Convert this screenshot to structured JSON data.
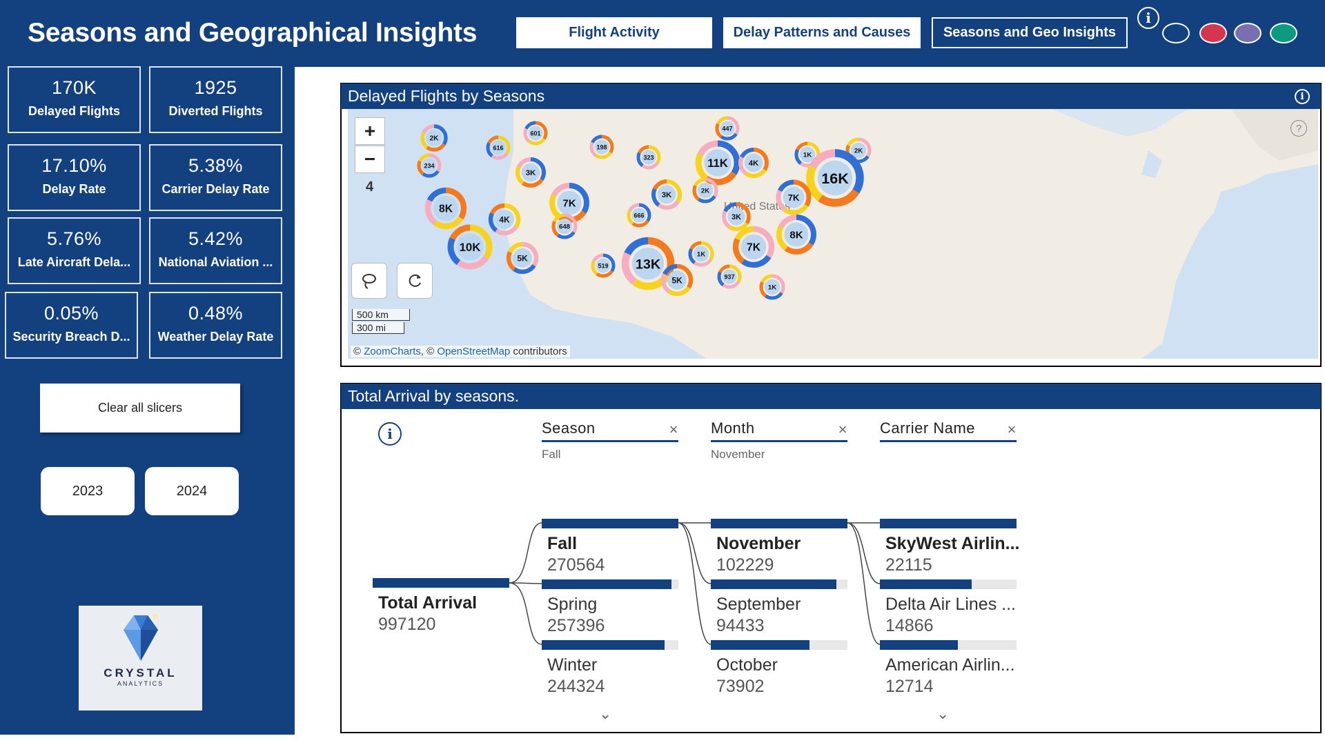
{
  "header": {
    "title": "Seasons and Geographical Insights",
    "nav": [
      "Flight Activity",
      "Delay Patterns and Causes",
      "Seasons and Geo Insights"
    ],
    "info_icon": "info-icon",
    "theme_colors": [
      "#13407f",
      "#d6354f",
      "#7a6fae",
      "#0d9b7f"
    ]
  },
  "kpis": [
    {
      "value": "170K",
      "label": "Delayed Flights"
    },
    {
      "value": "1925",
      "label": "Diverted Flights"
    },
    {
      "value": "17.10%",
      "label": "Delay Rate"
    },
    {
      "value": "5.38%",
      "label": "Carrier Delay Rate"
    },
    {
      "value": "5.76%",
      "label": "Late Aircraft Dela..."
    },
    {
      "value": "5.42%",
      "label": "National Aviation ..."
    },
    {
      "value": "0.05%",
      "label": "Security Breach D..."
    },
    {
      "value": "0.48%",
      "label": "Weather Delay Rate"
    }
  ],
  "sidebar": {
    "clear_label": "Clear all slicers",
    "years": [
      "2023",
      "2024"
    ],
    "logo_text": "CRYSTAL",
    "logo_sub": "ANALYTICS"
  },
  "map_panel": {
    "title": "Delayed Flights by Seasons",
    "zoom_in": "+",
    "zoom_out": "−",
    "zoom_level": "4",
    "country_label": "United States",
    "scale_km": "500 km",
    "scale_mi": "300 mi",
    "attribution_prefix": "© ",
    "attribution_zc": "ZoomCharts",
    "attribution_mid": ", © ",
    "attribution_osm": "OpenStreetMap",
    "attribution_suffix": " contributors",
    "help_icon": "?",
    "cluster_colors": [
      "#2f6fd6",
      "#f47a1f",
      "#f7d21e",
      "#f6adc0"
    ],
    "clusters": [
      "2K",
      "601",
      "616",
      "234",
      "3K",
      "198",
      "323",
      "447",
      "11K",
      "4K",
      "1K",
      "2K",
      "16K",
      "7K",
      "3K",
      "2K",
      "7K",
      "8K",
      "4K",
      "648",
      "666",
      "3K",
      "10K",
      "5K",
      "519",
      "13K",
      "1K",
      "7K",
      "8K",
      "5K",
      "937",
      "1K"
    ]
  },
  "tree_panel": {
    "title": "Total Arrival by seasons.",
    "slicers": [
      {
        "name": "Season",
        "selected": "Fall"
      },
      {
        "name": "Month",
        "selected": "November"
      },
      {
        "name": "Carrier Name",
        "selected": ""
      }
    ],
    "close": "×",
    "root": {
      "label": "Total Arrival",
      "value": "997120"
    },
    "seasons": [
      {
        "label": "Fall",
        "value": "270564",
        "share": 1.0
      },
      {
        "label": "Spring",
        "value": "257396",
        "share": 0.95
      },
      {
        "label": "Winter",
        "value": "244324",
        "share": 0.9
      }
    ],
    "months": [
      {
        "label": "November",
        "value": "102229",
        "share": 1.0
      },
      {
        "label": "September",
        "value": "94433",
        "share": 0.92
      },
      {
        "label": "October",
        "value": "73902",
        "share": 0.72
      }
    ],
    "carriers": [
      {
        "label": "SkyWest Airlin...",
        "value": "22115",
        "share": 1.0
      },
      {
        "label": "Delta Air Lines ...",
        "value": "14866",
        "share": 0.67
      },
      {
        "label": "American Airlin...",
        "value": "12714",
        "share": 0.57
      }
    ],
    "chevron": "⌄"
  }
}
